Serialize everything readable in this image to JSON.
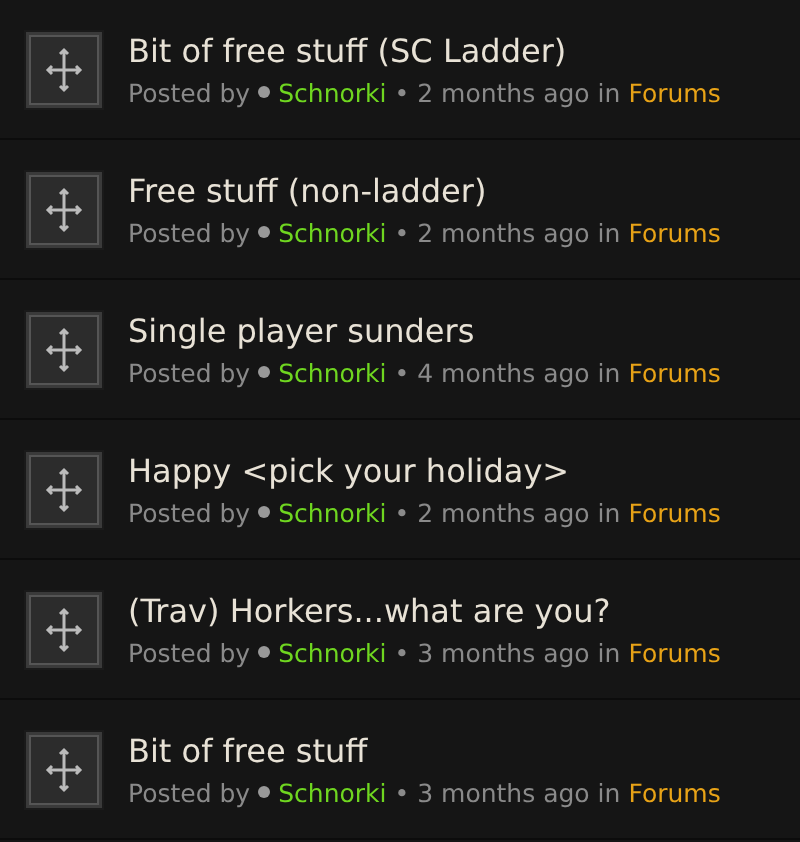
{
  "posts": [
    {
      "title": "Bit of free stuff (SC Ladder)",
      "posted_by": "Posted by",
      "author": "Schnorki",
      "time": "• 2 months ago in",
      "forum": "Forums"
    },
    {
      "title": "Free stuff (non-ladder)",
      "posted_by": "Posted by",
      "author": "Schnorki",
      "time": "• 2 months ago in",
      "forum": "Forums"
    },
    {
      "title": "Single player sunders",
      "posted_by": "Posted by",
      "author": "Schnorki",
      "time": "• 4 months ago in",
      "forum": "Forums"
    },
    {
      "title": "Happy <pick your holiday>",
      "posted_by": "Posted by",
      "author": "Schnorki",
      "time": "• 2 months ago in",
      "forum": "Forums"
    },
    {
      "title": "(Trav) Horkers...what are you?",
      "posted_by": "Posted by",
      "author": "Schnorki",
      "time": "• 3 months ago in",
      "forum": "Forums"
    },
    {
      "title": "Bit of free stuff",
      "posted_by": "Posted by",
      "author": "Schnorki",
      "time": "• 3 months ago in",
      "forum": "Forums"
    }
  ]
}
